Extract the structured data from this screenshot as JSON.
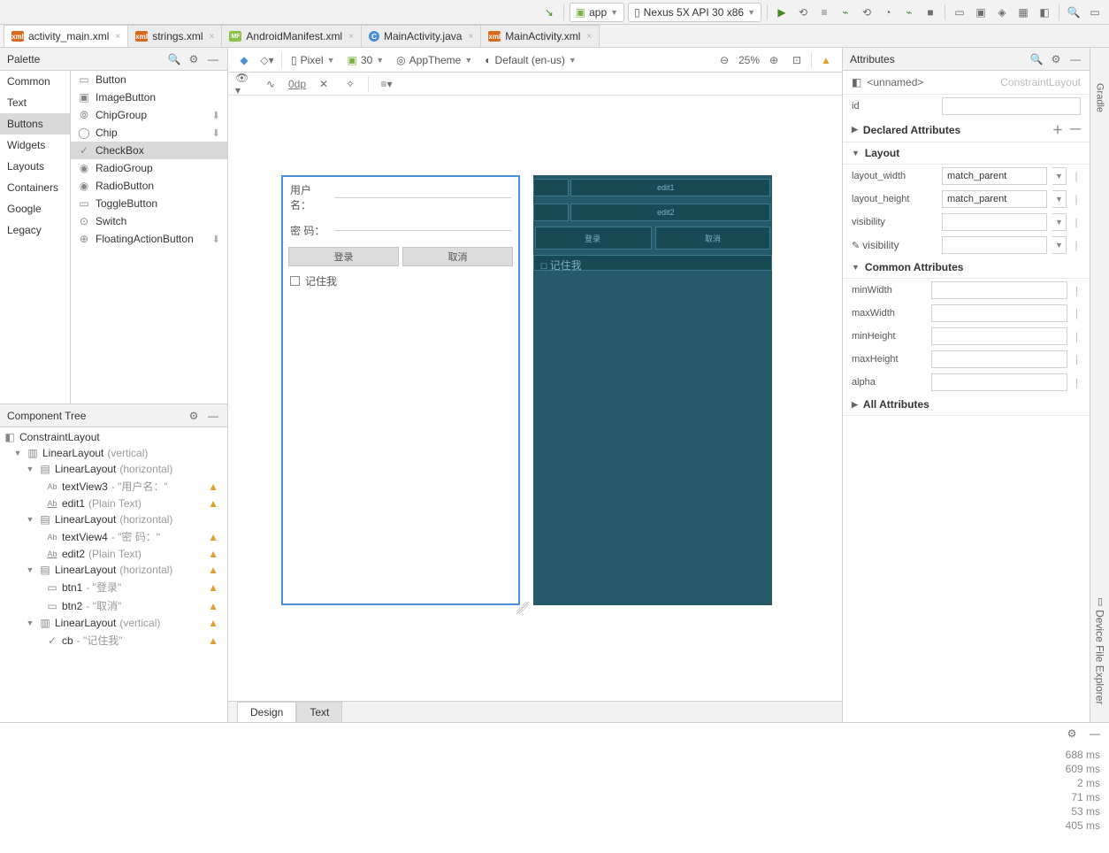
{
  "toolbar": {
    "sync": "↘",
    "run_config": "app",
    "device": "Nexus 5X API 30 x86"
  },
  "tabs": [
    {
      "label": "activity_main.xml",
      "kind": "xml",
      "active": true
    },
    {
      "label": "strings.xml",
      "kind": "xml",
      "active": false
    },
    {
      "label": "AndroidManifest.xml",
      "kind": "mf",
      "active": false
    },
    {
      "label": "MainActivity.java",
      "kind": "java",
      "active": false
    },
    {
      "label": "MainActivity.xml",
      "kind": "xml",
      "active": false
    }
  ],
  "palette": {
    "title": "Palette",
    "cats": [
      "Common",
      "Text",
      "Buttons",
      "Widgets",
      "Layouts",
      "Containers",
      "Google",
      "Legacy"
    ],
    "selected_cat": "Buttons",
    "items": [
      {
        "label": "Button",
        "dl": false
      },
      {
        "label": "ImageButton",
        "dl": false
      },
      {
        "label": "ChipGroup",
        "dl": true
      },
      {
        "label": "Chip",
        "dl": true
      },
      {
        "label": "CheckBox",
        "dl": false,
        "sel": true
      },
      {
        "label": "RadioGroup",
        "dl": false
      },
      {
        "label": "RadioButton",
        "dl": false
      },
      {
        "label": "ToggleButton",
        "dl": false
      },
      {
        "label": "Switch",
        "dl": false
      },
      {
        "label": "FloatingActionButton",
        "dl": true
      }
    ]
  },
  "component_tree": {
    "title": "Component Tree",
    "root": "ConstraintLayout",
    "ll1": "LinearLayout",
    "ll1h": "(vertical)",
    "llh": "LinearLayout",
    "llhh": "(horizontal)",
    "tv3": "textView3",
    "tv3h": "- \"用户名：\"",
    "e1": "edit1",
    "e1h": "(Plain Text)",
    "tv4": "textView4",
    "tv4h": "- \"密    码：\"",
    "e2": "edit2",
    "e2h": "(Plain Text)",
    "b1": "btn1",
    "b1h": "- \"登录\"",
    "b2": "btn2",
    "b2h": "- \"取消\"",
    "llv": "LinearLayout",
    "llvh": "(vertical)",
    "cb": "cb",
    "cbh": "- \"记住我\""
  },
  "design_tb": {
    "device": "Pixel",
    "api": "30",
    "theme": "AppTheme",
    "locale": "Default (en-us)",
    "zoom": "25%",
    "margin": "0dp"
  },
  "preview": {
    "user_label": "用户名：",
    "pwd_label": "密    码：",
    "login": "登录",
    "cancel": "取消",
    "remember": "记住我",
    "bp_e1": "edit1",
    "bp_e2": "edit2",
    "bp_login": "登录",
    "bp_cancel": "取消",
    "bp_cb": "记住我"
  },
  "attributes": {
    "title": "Attributes",
    "unnamed": "<unnamed>",
    "type": "ConstraintLayout",
    "id_label": "id",
    "decl": "Declared Attributes",
    "layout": "Layout",
    "lw": "layout_width",
    "lw_v": "match_parent",
    "lh": "layout_height",
    "lh_v": "match_parent",
    "vis": "visibility",
    "vis2": "visibility",
    "common": "Common Attributes",
    "minw": "minWidth",
    "maxw": "maxWidth",
    "minh": "minHeight",
    "maxh": "maxHeight",
    "alpha": "alpha",
    "all": "All Attributes"
  },
  "bottom": {
    "design": "Design",
    "text": "Text"
  },
  "build": {
    "times": [
      "688 ms",
      "609 ms",
      "2 ms",
      "71 ms",
      "53 ms",
      "405 ms"
    ]
  },
  "rail": {
    "gradle": "Gradle",
    "explorer": "Device File Explorer"
  }
}
